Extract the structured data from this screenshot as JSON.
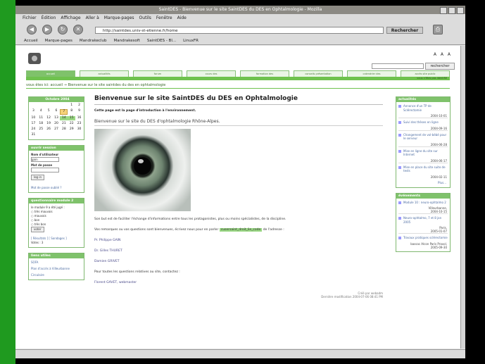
{
  "window": {
    "title": "SaintDES - Bienvenue sur le site SaintDES du DES en Ophtalmologie - Mozilla"
  },
  "menu": [
    "Fichier",
    "Édition",
    "Affichage",
    "Aller à",
    "Marque-pages",
    "Outils",
    "Fenêtre",
    "Aide"
  ],
  "nav": {
    "url": "http://saintdes.univ-st-etienne.fr/home",
    "search_label": "Rechercher"
  },
  "bookmarks": [
    "Accueil",
    "Marque-pages",
    "Mandrakeclub",
    "Mandrakesoft",
    "SaintDES - Bl...",
    "LinuxFR"
  ],
  "site": {
    "search_button": "rechercher",
    "font_controls": "A A A",
    "tabs": [
      "accueil",
      "actualités",
      "forum",
      "cours des",
      "formation des",
      "conseils présentation",
      "calendrier des",
      "accès site public"
    ],
    "member_line": "vous n'êtes pas identifié",
    "breadcrumb": "vous êtes ici: accueil → Bienvenue sur le site saintdes du des en ophtalmologie"
  },
  "calendar": {
    "month": "Octobre 2004",
    "days": [
      "",
      "",
      "",
      "",
      "",
      "1",
      "2",
      "3",
      "4",
      "5",
      "6",
      "7",
      "8",
      "9",
      "10",
      "11",
      "12",
      "13",
      "14",
      "15",
      "16",
      "17",
      "18",
      "19",
      "20",
      "21",
      "22",
      "23",
      "24",
      "25",
      "26",
      "27",
      "28",
      "29",
      "30",
      "31"
    ],
    "today": "7",
    "highlight": [
      "14",
      "15"
    ]
  },
  "login": {
    "title": "ouvrir session",
    "username_label": "Nom d'utilisateur",
    "username_value": "gain",
    "password_label": "Mot de passe",
    "button": "log in",
    "forgot": "Mot de passe oublié ?"
  },
  "poll": {
    "title": "questionnaire module 2",
    "question": "le module 9 a été jugé :",
    "options": [
      "très mauvais",
      "mauvais",
      "bon",
      "très bon"
    ],
    "vote": "voter",
    "results": "[ Résultats ] [ Sondages ]",
    "votes": "Votes : 3"
  },
  "links": {
    "title": "liens utiles",
    "items": [
      "SOFA",
      "Plan d'accès à Villeurbanne",
      "Circulaire"
    ]
  },
  "main": {
    "title": "Bienvenue sur le site SaintDES du DES en Ophtalmologie",
    "intro": "Cette page est la page d'introduction à l'environnement.",
    "subtitle": "Bienvenue sur le site du DES d'ophtalmologie Rhône-Alpes.",
    "p1": "Son but est de faciliter l'échange d'informations entre tous les protagonistes, plus ou moins spécialistes, de la discipline.",
    "p2_start": "Vos remarques ou vos questions sont bienvenues, écrivez nous pour en parler",
    "p2_link": "cusersaint_droit_lie_code",
    "p2_end": "de l'adresse :",
    "contacts": [
      "Pr. Philippe GAIN",
      "Dr. Gilles THURET",
      "Damien GRIVET"
    ],
    "questions_text": "Pour toutes les questions relatives au site, contactez :",
    "webmaster": "Florent GAVET, webmaster",
    "created": "Créé par webadm",
    "modified": "Dernière modification 2004-07-06 08:41 PM"
  },
  "actualites": {
    "title": "actualités",
    "items": [
      {
        "text": "Annonce d'un TP de Sclérectomie",
        "date": "2004-10-01"
      },
      {
        "text": "Suivi des thèses en ligne",
        "date": "2004-09-16"
      },
      {
        "text": "Changement de vol-bébé pour le serveur",
        "date": "2004-06-28"
      },
      {
        "text": "Mise en ligne du site sur Internet",
        "date": "2004-06-17"
      },
      {
        "text": "Mise en place du site suite de tests",
        "date": "2004-02-11"
      }
    ],
    "more": "Plus..."
  },
  "evenements": {
    "title": "événements",
    "items": [
      {
        "text": "Module 10 : neuro-ophtalmo 2",
        "place": "Villeurbanne,",
        "date": "2004-10-15"
      },
      {
        "text": "Neuro-ophtalmo, 7 et 8 jan 2005",
        "place": "Paris,",
        "date": "2005-01-07"
      },
      {
        "text": "Travaux pratiques sclérectomie",
        "place": "bassac Alcon Paris Pravol,",
        "date": "2005-09-30"
      }
    ]
  }
}
